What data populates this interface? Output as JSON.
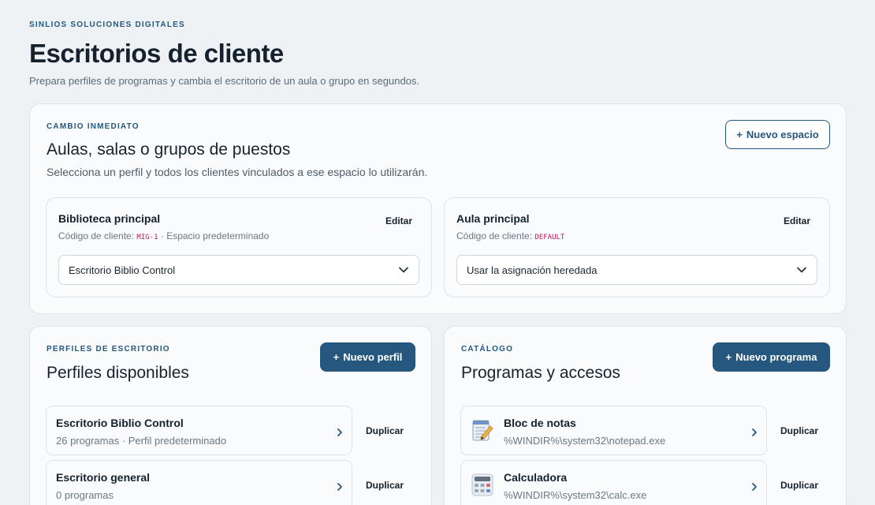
{
  "header": {
    "brand": "SINLIOS SOLUCIONES DIGITALES",
    "title": "Escritorios de cliente",
    "subtitle": "Prepara perfiles de programas y cambia el escritorio de un aula o grupo en segundos."
  },
  "spaces_card": {
    "eyebrow": "CAMBIO INMEDIATO",
    "title": "Aulas, salas o grupos de puestos",
    "description": "Selecciona un perfil y todos los clientes vinculados a ese espacio lo utilizarán.",
    "new_button": "Nuevo espacio",
    "new_button_icon": "plus-icon",
    "spaces": [
      {
        "name": "Biblioteca principal",
        "edit_label": "Editar",
        "code_label": "Código de cliente:",
        "code": "MIG-1",
        "note": "· Espacio predeterminado",
        "selected_profile": "Escritorio Biblio Control"
      },
      {
        "name": "Aula principal",
        "edit_label": "Editar",
        "code_label": "Código de cliente:",
        "code": "DEFAULT",
        "note": "",
        "selected_profile": "Usar la asignación heredada"
      }
    ]
  },
  "profiles_card": {
    "eyebrow": "PERFILES DE ESCRITORIO",
    "title": "Perfiles disponibles",
    "new_button": "Nuevo perfil",
    "profiles": [
      {
        "name": "Escritorio Biblio Control",
        "meta": "26 programas · Perfil predeterminado",
        "duplicate": "Duplicar"
      },
      {
        "name": "Escritorio general",
        "meta": "0 programas",
        "duplicate": "Duplicar"
      }
    ]
  },
  "catalog_card": {
    "eyebrow": "CATÁLOGO",
    "title": "Programas y accesos",
    "new_button": "Nuevo programa",
    "programs": [
      {
        "name": "Bloc de notas",
        "path": "%WINDIR%\\system32\\notepad.exe",
        "icon": "notepad-icon",
        "duplicate": "Duplicar"
      },
      {
        "name": "Calculadora",
        "path": "%WINDIR%\\system32\\calc.exe",
        "icon": "calculator-icon",
        "duplicate": "Duplicar"
      }
    ]
  },
  "colors": {
    "accent": "#26577f",
    "background": "#eef2f5",
    "code": "#c2185b"
  }
}
